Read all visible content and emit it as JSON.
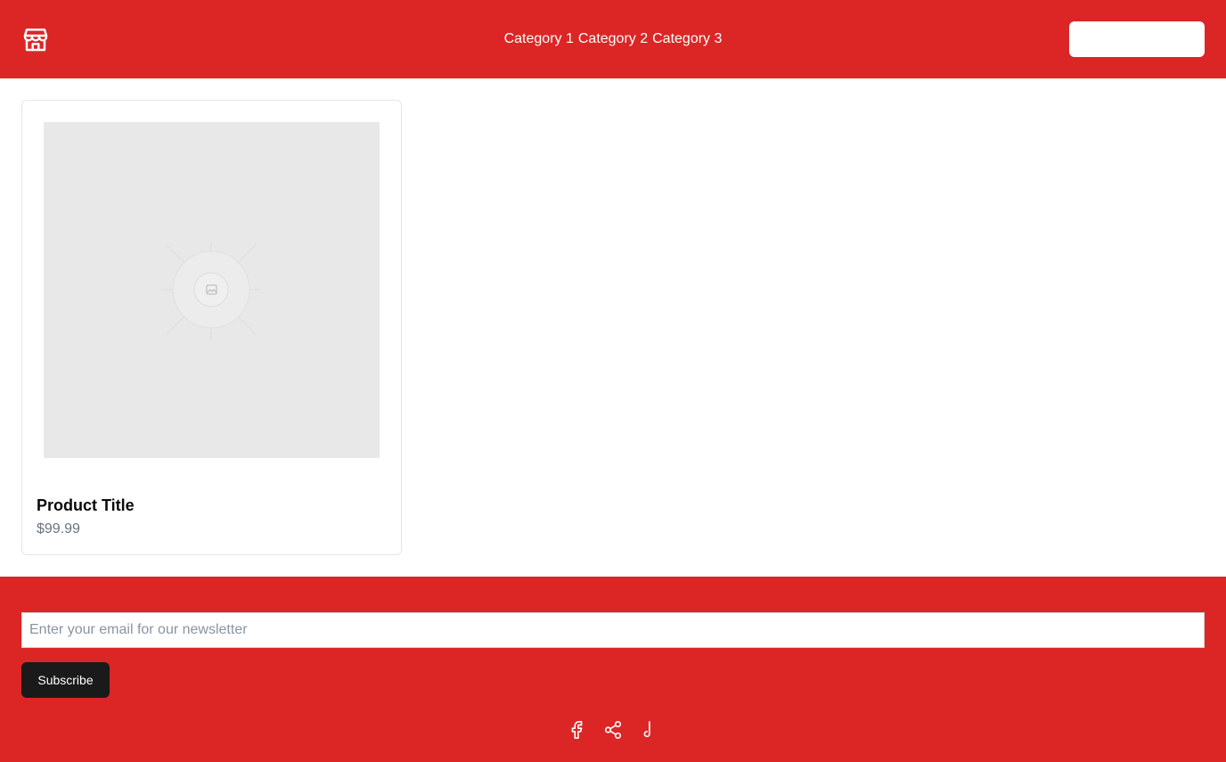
{
  "header": {
    "logo_icon": "store-icon",
    "nav": [
      "Category 1",
      "Category 2",
      "Category 3"
    ],
    "accent_color": "#dc2626"
  },
  "product": {
    "title": "Product Title",
    "price": "$99.99",
    "image_icon": "image-placeholder-icon"
  },
  "footer": {
    "email_placeholder": "Enter your email for our newsletter",
    "subscribe_label": "Subscribe",
    "social_icons": [
      "facebook-icon",
      "share-icon",
      "tiktok-icon"
    ]
  }
}
